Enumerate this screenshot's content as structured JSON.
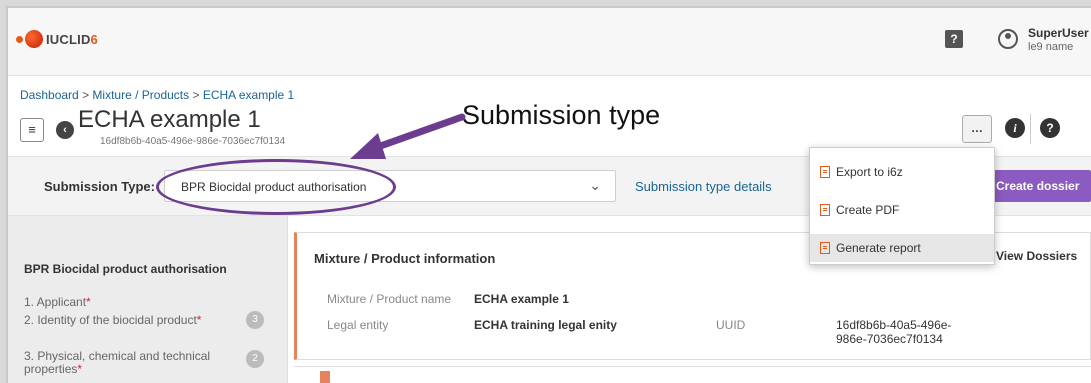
{
  "app": {
    "logo_text": "IUCLID",
    "logo_version": "6"
  },
  "user": {
    "name": "SuperUser",
    "sub": "le9 name"
  },
  "breadcrumb": {
    "items": [
      "Dashboard",
      "Mixture / Products",
      "ECHA example 1"
    ],
    "sep": ">"
  },
  "title": {
    "text": "ECHA example 1",
    "uuid": "16df8b6b-40a5-496e-986e-7036ec7f0134"
  },
  "submission": {
    "label": "Submission Type:",
    "value": "BPR Biocidal product authorisation",
    "details_link": "Submission type details",
    "create_button": "Create dossier"
  },
  "menu": {
    "items": [
      "Export to i6z",
      "Create PDF",
      "Generate report"
    ],
    "active_index": 2
  },
  "sidebar": {
    "heading": "BPR Biocidal product authorisation",
    "items": [
      {
        "label": "1. Applicant",
        "required": "*",
        "count": ""
      },
      {
        "label": "2. Identity of the biocidal product",
        "required": "*",
        "count": "3"
      },
      {
        "label": "3. Physical, chemical and technical",
        "label2": "properties",
        "required": "*",
        "count": "2"
      }
    ]
  },
  "panel": {
    "title": "Mixture / Product information",
    "view_link": "View Dossiers",
    "fields": {
      "name_label": "Mixture / Product name",
      "name_value": "ECHA example 1",
      "entity_label": "Legal entity",
      "entity_value": "ECHA training legal enity",
      "uuid_label": "UUID",
      "uuid_value_1": "16df8b6b-40a5-496e-",
      "uuid_value_2": "986e-7036ec7f0134"
    }
  },
  "annotation": {
    "text": "Submission type",
    "color": "#6c3d8f"
  },
  "colors": {
    "accent": "#e25a1c",
    "create_button": "#8c5bc1",
    "link": "#1a6496"
  }
}
